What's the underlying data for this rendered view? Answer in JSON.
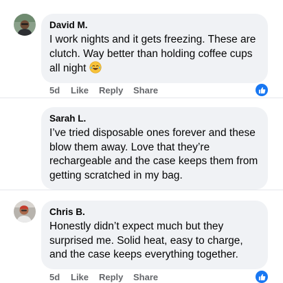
{
  "comments": [
    {
      "author": "David M.",
      "text": "I work nights and it gets freezing. These are clutch. Way better than holding coffee cups all night",
      "emoji": "face-with-tears-of-joy-icon",
      "time": "5d",
      "like_label": "Like",
      "reply_label": "Reply",
      "share_label": "Share",
      "has_like_badge": true
    },
    {
      "author": "Sarah L.",
      "text": "I’ve tried disposable ones forever and these blow them away. Love that they’re rechargeable and the case keeps them from getting scratched in my bag.",
      "has_like_badge": false
    },
    {
      "author": "Chris B.",
      "text": "Honestly didn’t expect much but they surprised me. Solid heat, easy to charge, and the case keeps everything together.",
      "time": "5d",
      "like_label": "Like",
      "reply_label": "Reply",
      "share_label": "Share",
      "has_like_badge": true
    }
  ],
  "colors": {
    "bubble": "#f0f2f5",
    "meta_text": "#65676b",
    "like_blue": "#1877f2",
    "divider": "#e4e6eb"
  }
}
